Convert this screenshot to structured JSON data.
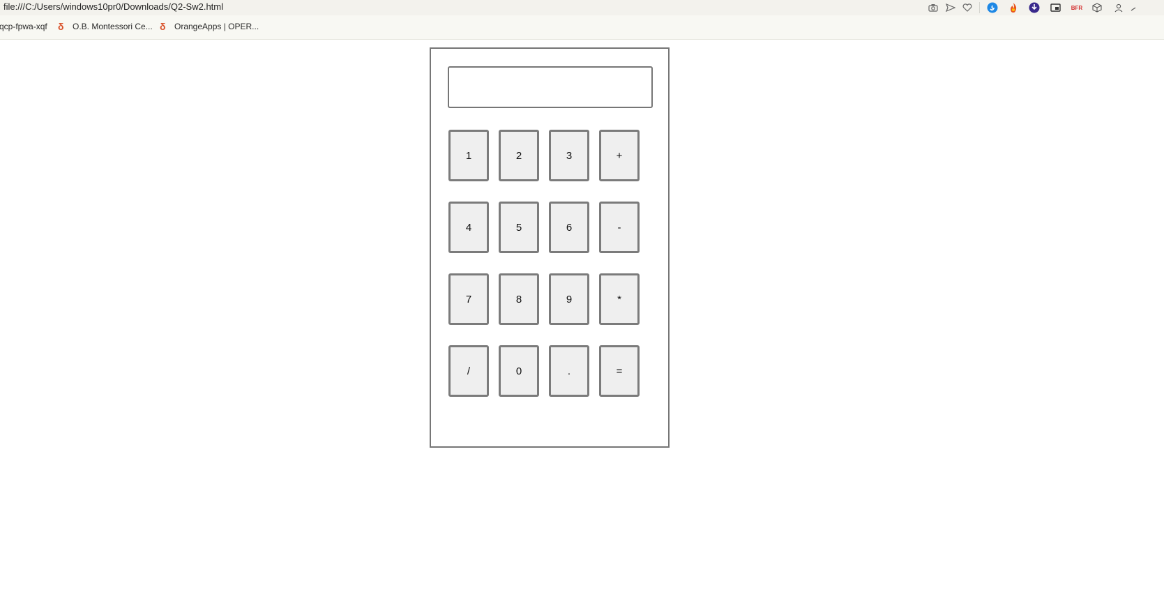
{
  "browser": {
    "url": "file:///C:/Users/windows10pr0/Downloads/Q2-Sw2.html",
    "toolbar_icons": [
      "camera-icon",
      "send-icon",
      "heart-icon",
      "shazam-icon",
      "fire-icon",
      "download-icon",
      "picture-in-picture-icon",
      "brand-icon",
      "box-icon",
      "user-icon"
    ],
    "brand_icon_text": "BFR"
  },
  "bookmarks": [
    {
      "label": "qcp-fpwa-xqf"
    },
    {
      "label": "O.B. Montessori Ce..."
    },
    {
      "label": "OrangeApps | OPER..."
    }
  ],
  "calculator": {
    "display_value": "",
    "keys": [
      [
        "1",
        "2",
        "3",
        "+"
      ],
      [
        "4",
        "5",
        "6",
        "-"
      ],
      [
        "7",
        "8",
        "9",
        "*"
      ],
      [
        "/",
        "0",
        ".",
        "="
      ]
    ]
  },
  "colors": {
    "border": "#767676",
    "key_background": "#efefef",
    "bookmark_icon": "#d9532c"
  }
}
